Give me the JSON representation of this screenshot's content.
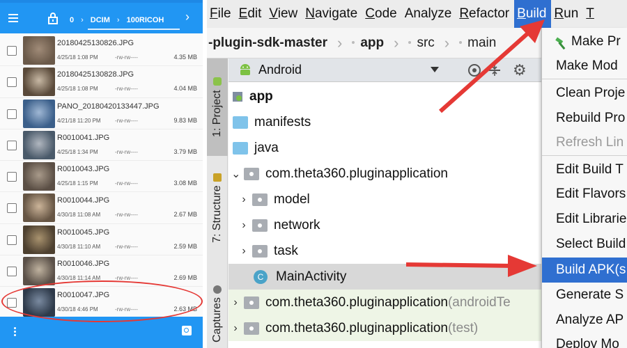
{
  "file_manager": {
    "header": {
      "path_count": "0",
      "path_segments": [
        "DCIM",
        "100RICOH"
      ]
    },
    "files": [
      {
        "name": "20180425130826.JPG",
        "date": "4/25/18 1:08 PM",
        "perm": "-rw-rw----",
        "size": "4.35 MB"
      },
      {
        "name": "20180425130828.JPG",
        "date": "4/25/18 1:08 PM",
        "perm": "-rw-rw----",
        "size": "4.04 MB"
      },
      {
        "name": "PANO_20180420133447.JPG",
        "date": "4/21/18 11:20 PM",
        "perm": "-rw-rw----",
        "size": "9.83 MB"
      },
      {
        "name": "R0010041.JPG",
        "date": "4/25/18 1:34 PM",
        "perm": "-rw-rw----",
        "size": "3.79 MB"
      },
      {
        "name": "R0010043.JPG",
        "date": "4/25/18 1:15 PM",
        "perm": "-rw-rw----",
        "size": "3.08 MB"
      },
      {
        "name": "R0010044.JPG",
        "date": "4/30/18 11:08 AM",
        "perm": "-rw-rw----",
        "size": "2.67 MB"
      },
      {
        "name": "R0010045.JPG",
        "date": "4/30/18 11:10 AM",
        "perm": "-rw-rw----",
        "size": "2.59 MB"
      },
      {
        "name": "R0010046.JPG",
        "date": "4/30/18 11:14 AM",
        "perm": "-rw-rw----",
        "size": "2.69 MB"
      },
      {
        "name": "R0010047.JPG",
        "date": "4/30/18 4:46 PM",
        "perm": "-rw-rw----",
        "size": "2.63 MB"
      }
    ]
  },
  "ide": {
    "menu": [
      {
        "label": "File",
        "ul": "F",
        "rest": "ile"
      },
      {
        "label": "Edit",
        "ul": "E",
        "rest": "dit"
      },
      {
        "label": "View",
        "ul": "V",
        "rest": "iew"
      },
      {
        "label": "Navigate",
        "ul": "N",
        "rest": "avigate"
      },
      {
        "label": "Code",
        "ul": "C",
        "rest": "ode"
      },
      {
        "label": "Analyze",
        "ul": "",
        "rest": "Analyze"
      },
      {
        "label": "Refactor",
        "ul": "R",
        "rest": "efactor"
      },
      {
        "label": "Build",
        "ul": "B",
        "rest": "uild"
      },
      {
        "label": "Run",
        "ul": "R",
        "rest": "un"
      },
      {
        "label": "T",
        "ul": "T",
        "rest": ""
      }
    ],
    "breadcrumb": {
      "project": "-plugin-sdk-master",
      "module": "app",
      "src": "src",
      "main": "main"
    },
    "side_tabs": {
      "project": "1: Project",
      "structure": "7: Structure",
      "captures": "Captures"
    },
    "project_view": {
      "selector": "Android"
    },
    "tree": [
      {
        "label": "app",
        "suffix": ""
      },
      {
        "label": "manifests",
        "suffix": ""
      },
      {
        "label": "java",
        "suffix": ""
      },
      {
        "label": "com.theta360.pluginapplication",
        "suffix": ""
      },
      {
        "label": "model",
        "suffix": ""
      },
      {
        "label": "network",
        "suffix": ""
      },
      {
        "label": "task",
        "suffix": ""
      },
      {
        "label": "MainActivity",
        "suffix": "",
        "badge": "C"
      },
      {
        "label": "com.theta360.pluginapplication",
        "suffix": " (androidTe"
      },
      {
        "label": "com.theta360.pluginapplication",
        "suffix": " (test)"
      }
    ],
    "build_menu": [
      {
        "label": "Make Pr"
      },
      {
        "label": "Make Mod"
      },
      {
        "label": "Clean Proje"
      },
      {
        "label": "Rebuild Pro"
      },
      {
        "label": "Refresh Lin"
      },
      {
        "label": "Edit Build T"
      },
      {
        "label": "Edit Flavors"
      },
      {
        "label": "Edit Librarie"
      },
      {
        "label": "Select Build"
      },
      {
        "label": "Build APK(s"
      },
      {
        "label": "Generate S"
      },
      {
        "label": "Analyze AP"
      },
      {
        "label": "Deploy Mo"
      }
    ]
  },
  "colors": {
    "fm_accent": "#2196f3",
    "ide_highlight": "#2f6fd0",
    "annotation_red": "#e53935"
  }
}
